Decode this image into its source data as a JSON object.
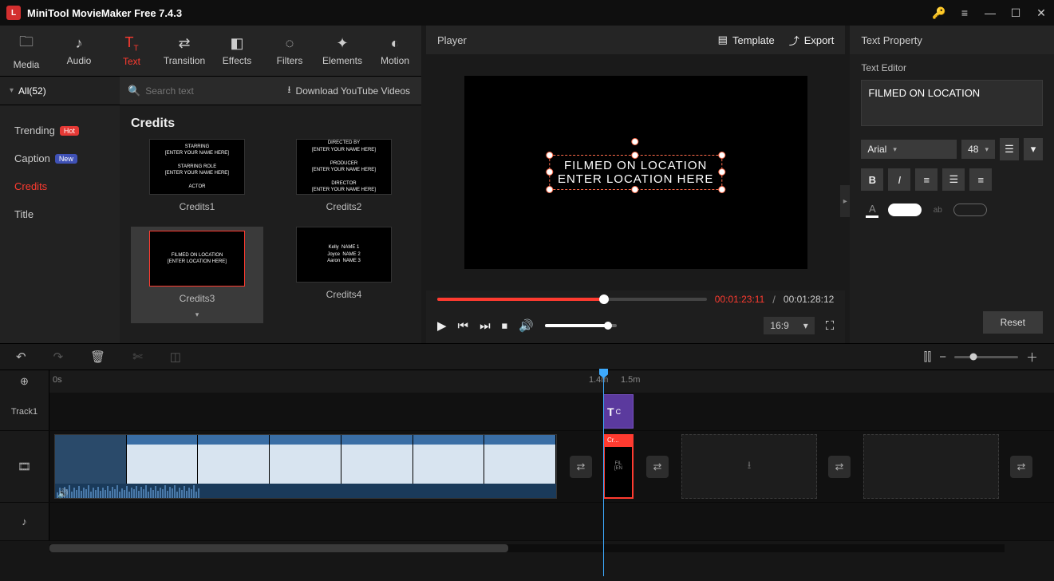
{
  "app": {
    "title": "MiniTool MovieMaker Free 7.4.3"
  },
  "tabs": {
    "media": "Media",
    "audio": "Audio",
    "text": "Text",
    "transition": "Transition",
    "effects": "Effects",
    "filters": "Filters",
    "elements": "Elements",
    "motion": "Motion"
  },
  "sub": {
    "all": "All(52)",
    "search_ph": "Search text",
    "download": "Download YouTube Videos"
  },
  "cats": {
    "trending": "Trending",
    "caption": "Caption",
    "credits": "Credits",
    "title": "Title",
    "hot": "Hot",
    "new": "New"
  },
  "grid": {
    "title": "Credits",
    "items": [
      {
        "label": "Credits1",
        "lines": [
          "STARRING",
          "[ENTER YOUR NAME HERE]",
          "",
          "STARRING ROLE",
          "[ENTER YOUR NAME HERE]",
          "",
          "ACTOR"
        ]
      },
      {
        "label": "Credits2",
        "lines": [
          "DIRECTED BY",
          "[ENTER YOUR NAME HERE]",
          "",
          "PRODUCER",
          "[ENTER YOUR NAME HERE]",
          "",
          "DIRECTOR",
          "[ENTER YOUR NAME HERE]"
        ]
      },
      {
        "label": "Credits3",
        "lines": [
          "FILMED ON LOCATION",
          "[ENTER LOCATION HERE]"
        ]
      },
      {
        "label": "Credits4",
        "lines": [
          "Kelly  NAME 1",
          "Joyce  NAME 2",
          "Aaron  NAME 3"
        ]
      }
    ]
  },
  "player": {
    "label": "Player",
    "template": "Template",
    "export": "Export",
    "line1": "FILMED ON LOCATION",
    "line2": "ENTER LOCATION HERE",
    "cur": "00:01:23:11",
    "tot": "00:01:28:12",
    "aspect": "16:9"
  },
  "prop": {
    "title": "Text Property",
    "editor": "Text Editor",
    "text_value": "FILMED ON LOCATION",
    "font": "Arial",
    "size": "48",
    "reset": "Reset"
  },
  "ruler": {
    "start": "0s",
    "m1": "1.4m",
    "m2": "1.5m"
  },
  "tracks": {
    "t1": "Track1",
    "textclip": "T",
    "textclip_c": "C",
    "credits_hdr": "Cr..."
  }
}
